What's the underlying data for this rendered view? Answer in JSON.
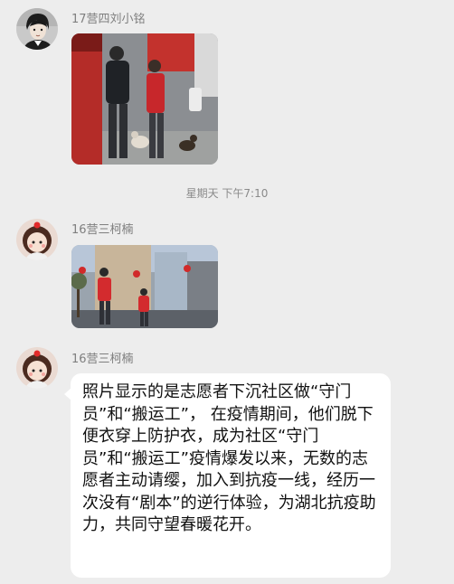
{
  "messages": [
    {
      "sender": "17营四刘小铭",
      "avatar_icon": "illustrated-man-avatar-icon",
      "content_type": "image",
      "image_desc": "volunteers with dogs at street checkpoint"
    },
    {
      "sender": "16营三柯楠",
      "avatar_icon": "cartoon-girl-avatar-icon",
      "content_type": "image",
      "image_desc": "two volunteers in red vests on street"
    },
    {
      "sender": "16营三柯楠",
      "avatar_icon": "cartoon-girl-avatar-icon",
      "content_type": "text",
      "text": "照片显示的是志愿者下沉社区做“守门员”和“搬运工”， 在疫情期间，他们脱下便衣穿上防护衣，成为社区“守门员”和“搬运工”疫情爆发以来，无数的志愿者主动请缨，加入到抗疫一线，经历一次没有“剧本”的逆行体验，为湖北抗疫助力，共同守望春暖花开。"
    }
  ],
  "timestamp": "星期天 下午7:10",
  "colors": {
    "background": "#ededed",
    "bubble": "#ffffff",
    "sender_name": "#7f7f7f",
    "timestamp": "#8a8a8a",
    "text": "#111111"
  }
}
